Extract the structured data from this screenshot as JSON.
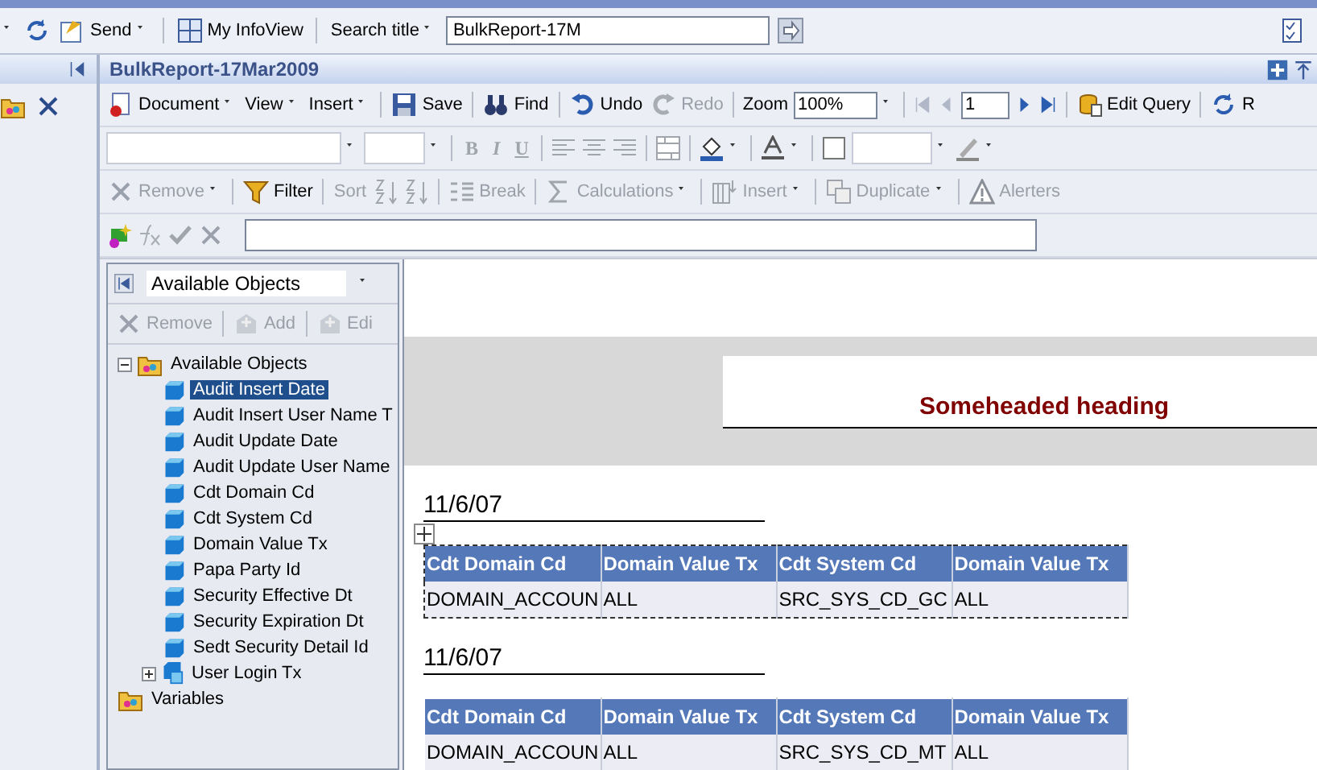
{
  "top_bar": {
    "send": "Send",
    "infoview": "My InfoView",
    "search_label": "Search title",
    "search_value": "BulkReport-17M"
  },
  "document": {
    "title": "BulkReport-17Mar2009"
  },
  "toolbar_main": [
    {
      "label": "Document",
      "kind": "menu",
      "disabled": false
    },
    {
      "label": "View",
      "kind": "menu",
      "disabled": false
    },
    {
      "label": "Insert",
      "kind": "menu",
      "disabled": false
    },
    {
      "label": "Save",
      "kind": "button",
      "disabled": false
    },
    {
      "label": "Find",
      "kind": "button",
      "disabled": false
    },
    {
      "label": "Undo",
      "kind": "button",
      "disabled": false
    },
    {
      "label": "Redo",
      "kind": "button",
      "disabled": true
    }
  ],
  "zoom": {
    "label": "Zoom",
    "value": "100%"
  },
  "page": {
    "value": "1"
  },
  "toolbar_main_end": [
    {
      "label": "Edit Query",
      "disabled": false
    },
    {
      "label": "R",
      "disabled": false
    }
  ],
  "format_buttons": [
    "B",
    "I",
    "U"
  ],
  "toolbar_report": [
    {
      "label": "Remove",
      "kind": "menu",
      "disabled": true
    },
    {
      "label": "Filter",
      "kind": "button",
      "disabled": false
    },
    {
      "label": "Sort",
      "kind": "sort",
      "disabled": true
    },
    {
      "label": "Break",
      "kind": "button",
      "disabled": true
    },
    {
      "label": "Calculations",
      "kind": "menu",
      "disabled": true
    },
    {
      "label": "Insert",
      "kind": "menu",
      "disabled": true
    },
    {
      "label": "Duplicate",
      "kind": "menu",
      "disabled": true
    },
    {
      "label": "Alerters",
      "kind": "button",
      "disabled": true
    }
  ],
  "side_panel": {
    "dropdown": "Available Objects",
    "actions": [
      {
        "label": "Remove",
        "disabled": true
      },
      {
        "label": "Add",
        "disabled": true
      },
      {
        "label": "Edi",
        "disabled": true
      }
    ],
    "tree": [
      {
        "label": "Available Objects",
        "expanded": true,
        "children": [
          {
            "label": "Audit Insert Date",
            "kind": "object",
            "selected": true
          },
          {
            "label": "Audit Insert User Name T",
            "kind": "object",
            "selected": false
          },
          {
            "label": "Audit Update Date",
            "kind": "object",
            "selected": false
          },
          {
            "label": "Audit Update User Name",
            "kind": "object",
            "selected": false
          },
          {
            "label": "Cdt Domain Cd",
            "kind": "object",
            "selected": false
          },
          {
            "label": "Cdt System Cd",
            "kind": "object",
            "selected": false
          },
          {
            "label": "Domain Value Tx",
            "kind": "object",
            "selected": false
          },
          {
            "label": "Papa Party Id",
            "kind": "object",
            "selected": false
          },
          {
            "label": "Security Effective Dt",
            "kind": "object",
            "selected": false
          },
          {
            "label": "Security Expiration Dt",
            "kind": "object",
            "selected": false
          },
          {
            "label": "Sedt Security Detail Id",
            "kind": "object",
            "selected": false
          },
          {
            "label": "User Login Tx",
            "kind": "group",
            "selected": false
          }
        ]
      },
      {
        "label": "Variables"
      }
    ]
  },
  "report": {
    "heading": "Someheaded heading",
    "sections": [
      {
        "date": "11/6/07",
        "selected": true,
        "columns": [
          "Cdt Domain Cd",
          "Domain Value Tx",
          "Cdt System Cd",
          "Domain Value Tx"
        ],
        "rows": [
          [
            "DOMAIN_ACCOUN",
            "ALL",
            "SRC_SYS_CD_GC",
            "ALL"
          ]
        ]
      },
      {
        "date": "11/6/07",
        "selected": false,
        "columns": [
          "Cdt Domain Cd",
          "Domain Value Tx",
          "Cdt System Cd",
          "Domain Value Tx"
        ],
        "rows": [
          [
            "DOMAIN_ACCOUN",
            "ALL",
            "SRC_SYS_CD_MT",
            "ALL"
          ]
        ]
      }
    ]
  }
}
